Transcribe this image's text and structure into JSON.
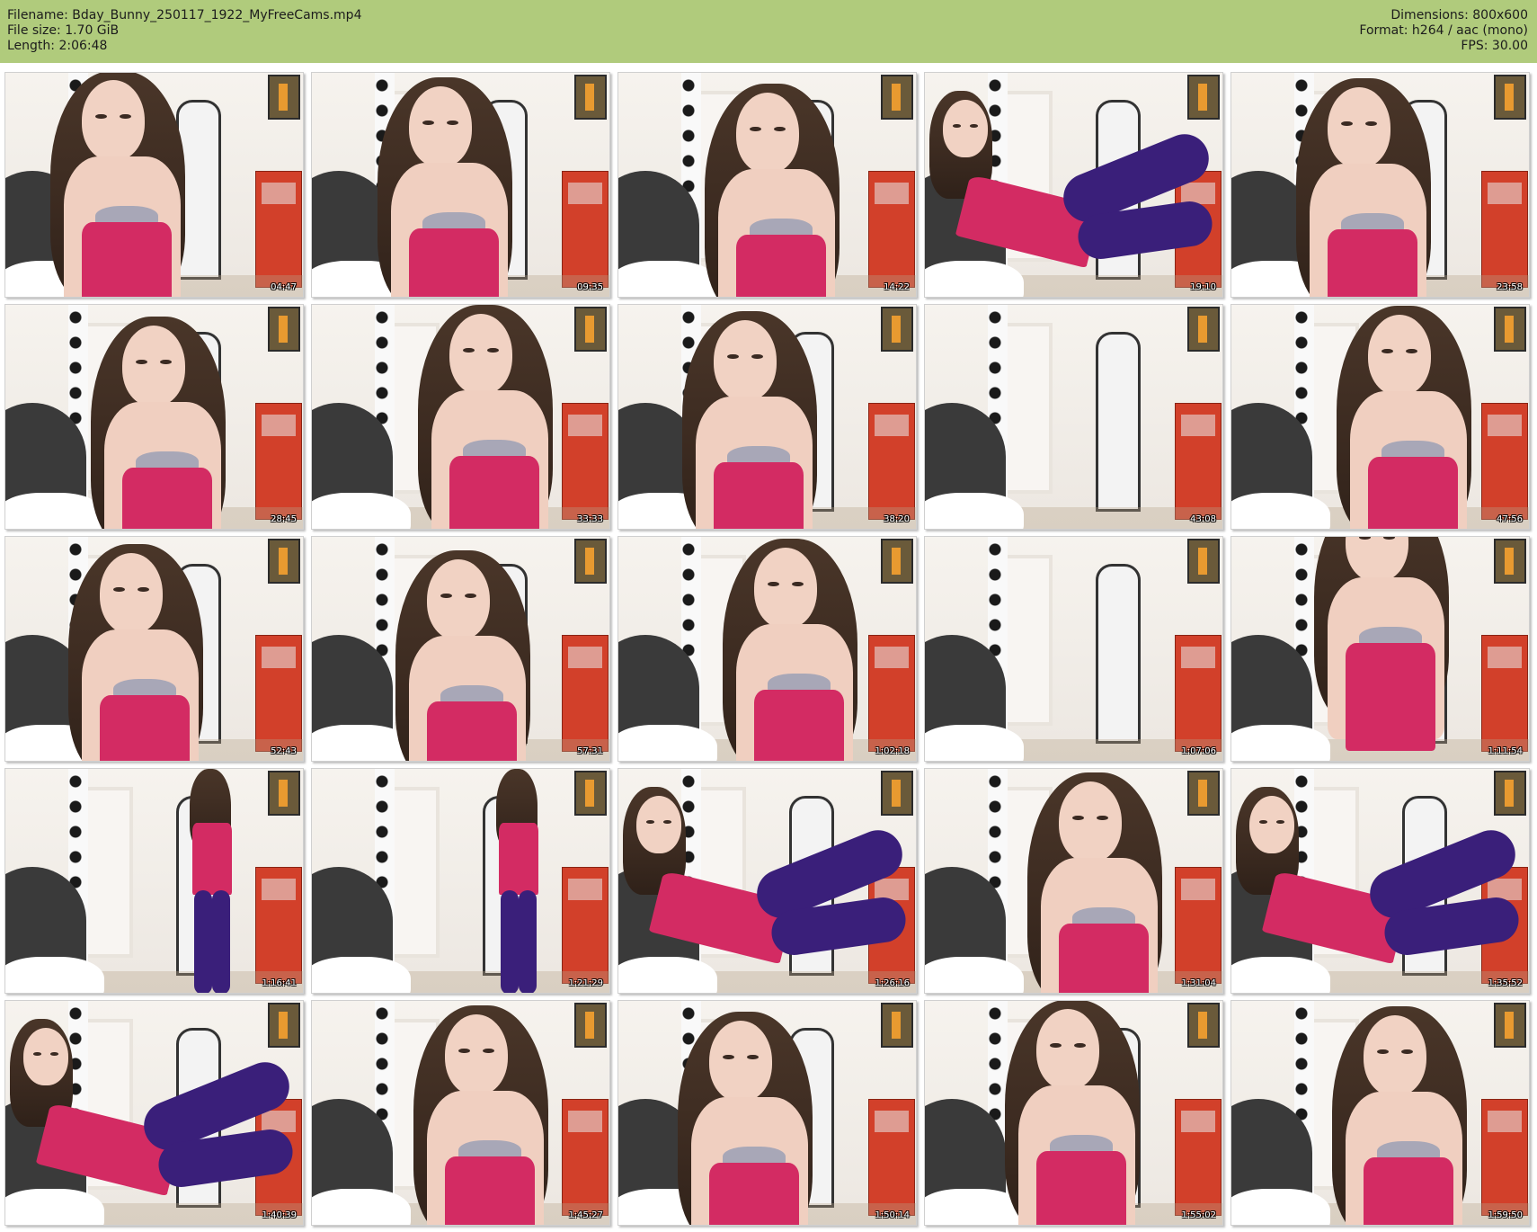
{
  "header": {
    "filename_label": "Filename: Bday_Bunny_250117_1922_MyFreeCams.mp4",
    "filesize_label": "File size: 1.70 GiB",
    "length_label": "Length: 2:06:48",
    "dimensions_label": "Dimensions: 800x600",
    "format_label": "Format: h264 / aac (mono)",
    "fps_label": "FPS: 30.00"
  },
  "thumbnails": [
    {
      "timestamp": "04:47",
      "scene": "close"
    },
    {
      "timestamp": "09:35",
      "scene": "close"
    },
    {
      "timestamp": "14:22",
      "scene": "close"
    },
    {
      "timestamp": "19:10",
      "scene": "lying"
    },
    {
      "timestamp": "23:58",
      "scene": "close"
    },
    {
      "timestamp": "28:45",
      "scene": "close"
    },
    {
      "timestamp": "33:33",
      "scene": "close"
    },
    {
      "timestamp": "38:20",
      "scene": "close"
    },
    {
      "timestamp": "43:08",
      "scene": "empty"
    },
    {
      "timestamp": "47:56",
      "scene": "close"
    },
    {
      "timestamp": "52:43",
      "scene": "close"
    },
    {
      "timestamp": "57:31",
      "scene": "close"
    },
    {
      "timestamp": "1:02:18",
      "scene": "close"
    },
    {
      "timestamp": "1:07:06",
      "scene": "empty"
    },
    {
      "timestamp": "1:11:54",
      "scene": "lean"
    },
    {
      "timestamp": "1:16:41",
      "scene": "standing"
    },
    {
      "timestamp": "1:21:29",
      "scene": "standing"
    },
    {
      "timestamp": "1:26:16",
      "scene": "lying"
    },
    {
      "timestamp": "1:31:04",
      "scene": "close"
    },
    {
      "timestamp": "1:35:52",
      "scene": "lying"
    },
    {
      "timestamp": "1:40:39",
      "scene": "lying"
    },
    {
      "timestamp": "1:45:27",
      "scene": "close"
    },
    {
      "timestamp": "1:50:14",
      "scene": "close"
    },
    {
      "timestamp": "1:55:02",
      "scene": "close"
    },
    {
      "timestamp": "1:59:50",
      "scene": "close"
    }
  ],
  "colors": {
    "header_bg": "#b0cb7c",
    "top": "#d32b63",
    "leggings": "#3a1f7a",
    "dresser": "#d2402a"
  }
}
